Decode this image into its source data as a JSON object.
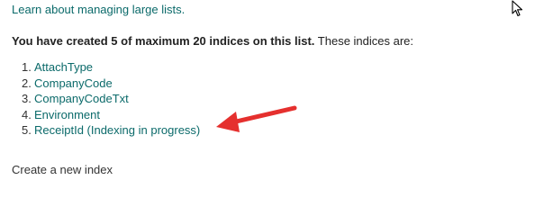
{
  "top_link": "Learn about managing large lists.",
  "summary": {
    "bold_text": "You have created 5 of maximum 20 indices on this list.",
    "normal_text": " These indices are:"
  },
  "indices": [
    {
      "number": "1.",
      "name": "AttachType"
    },
    {
      "number": "2.",
      "name": "CompanyCode"
    },
    {
      "number": "3.",
      "name": "CompanyCodeTxt"
    },
    {
      "number": "4.",
      "name": "Environment"
    },
    {
      "number": "5.",
      "name": "ReceiptId (Indexing in progress)"
    }
  ],
  "create_link": "Create a new index",
  "annotation": {
    "arrow_color": "#e5302e",
    "arrow_target": "ReceiptId (Indexing in progress)"
  },
  "colors": {
    "link": "#0b6a6a",
    "text": "#333333",
    "background": "#ffffff"
  },
  "icons": {
    "cursor": "mouse-pointer-icon"
  }
}
